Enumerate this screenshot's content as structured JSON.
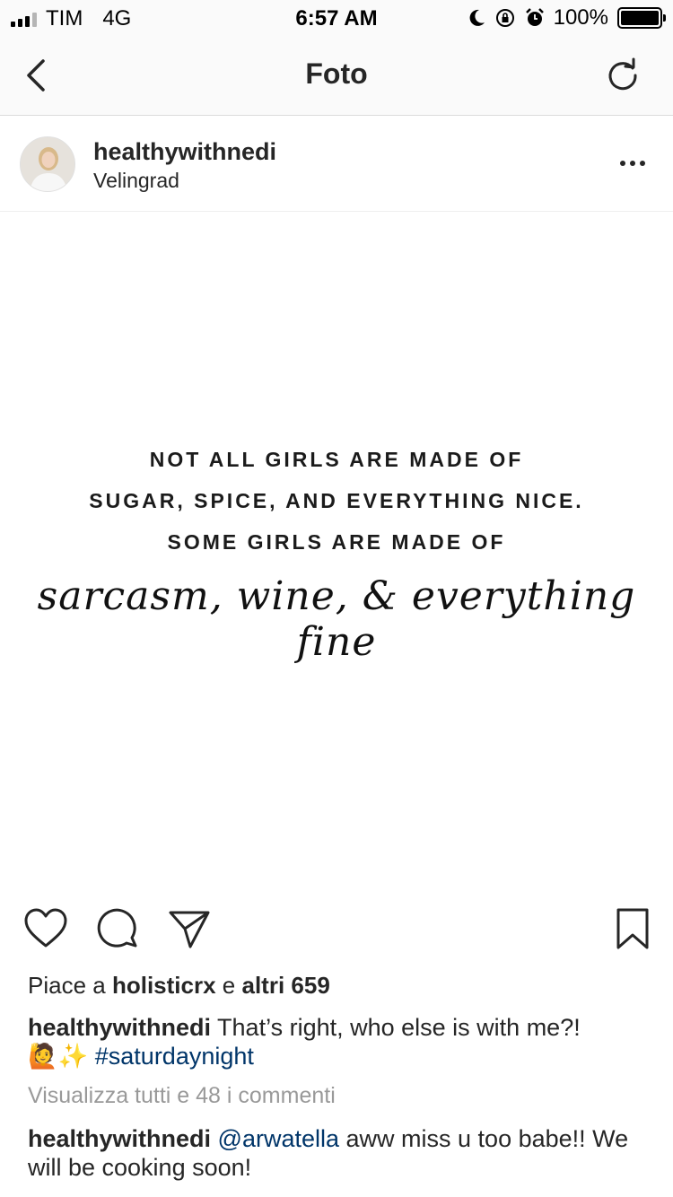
{
  "status_bar": {
    "carrier": "TIM",
    "network": "4G",
    "time": "6:57 AM",
    "battery": "100%",
    "battery_level": 1.0,
    "icons": [
      "signal-icon",
      "moon-icon",
      "rotation-lock-icon",
      "alarm-icon",
      "battery-icon"
    ]
  },
  "nav": {
    "title": "Foto",
    "back_icon": "chevron-left-icon",
    "refresh_icon": "refresh-icon"
  },
  "post": {
    "username": "healthywithnedi",
    "location": "Velingrad",
    "image_text": {
      "line1": "NOT ALL GIRLS ARE MADE OF",
      "line2": "SUGAR, SPICE, AND EVERYTHING NICE.",
      "line3": "SOME GIRLS ARE MADE OF",
      "line4": "sarcasm, wine, & everything fine"
    },
    "likes": {
      "prefix": "Piace a",
      "user": "holisticrx",
      "conj": "e",
      "others": "altri 659"
    },
    "caption": {
      "username": "healthywithnedi",
      "text": "That’s right, who else is with me?!",
      "emojis": "🙋✨",
      "hashtag": "#saturdaynight"
    },
    "view_comments": "Visualizza tutti e 48 i commenti",
    "comment": {
      "username": "healthywithnedi",
      "mention": "@arwatella",
      "text": "aww miss u too babe!! We will be cooking soon!"
    }
  }
}
